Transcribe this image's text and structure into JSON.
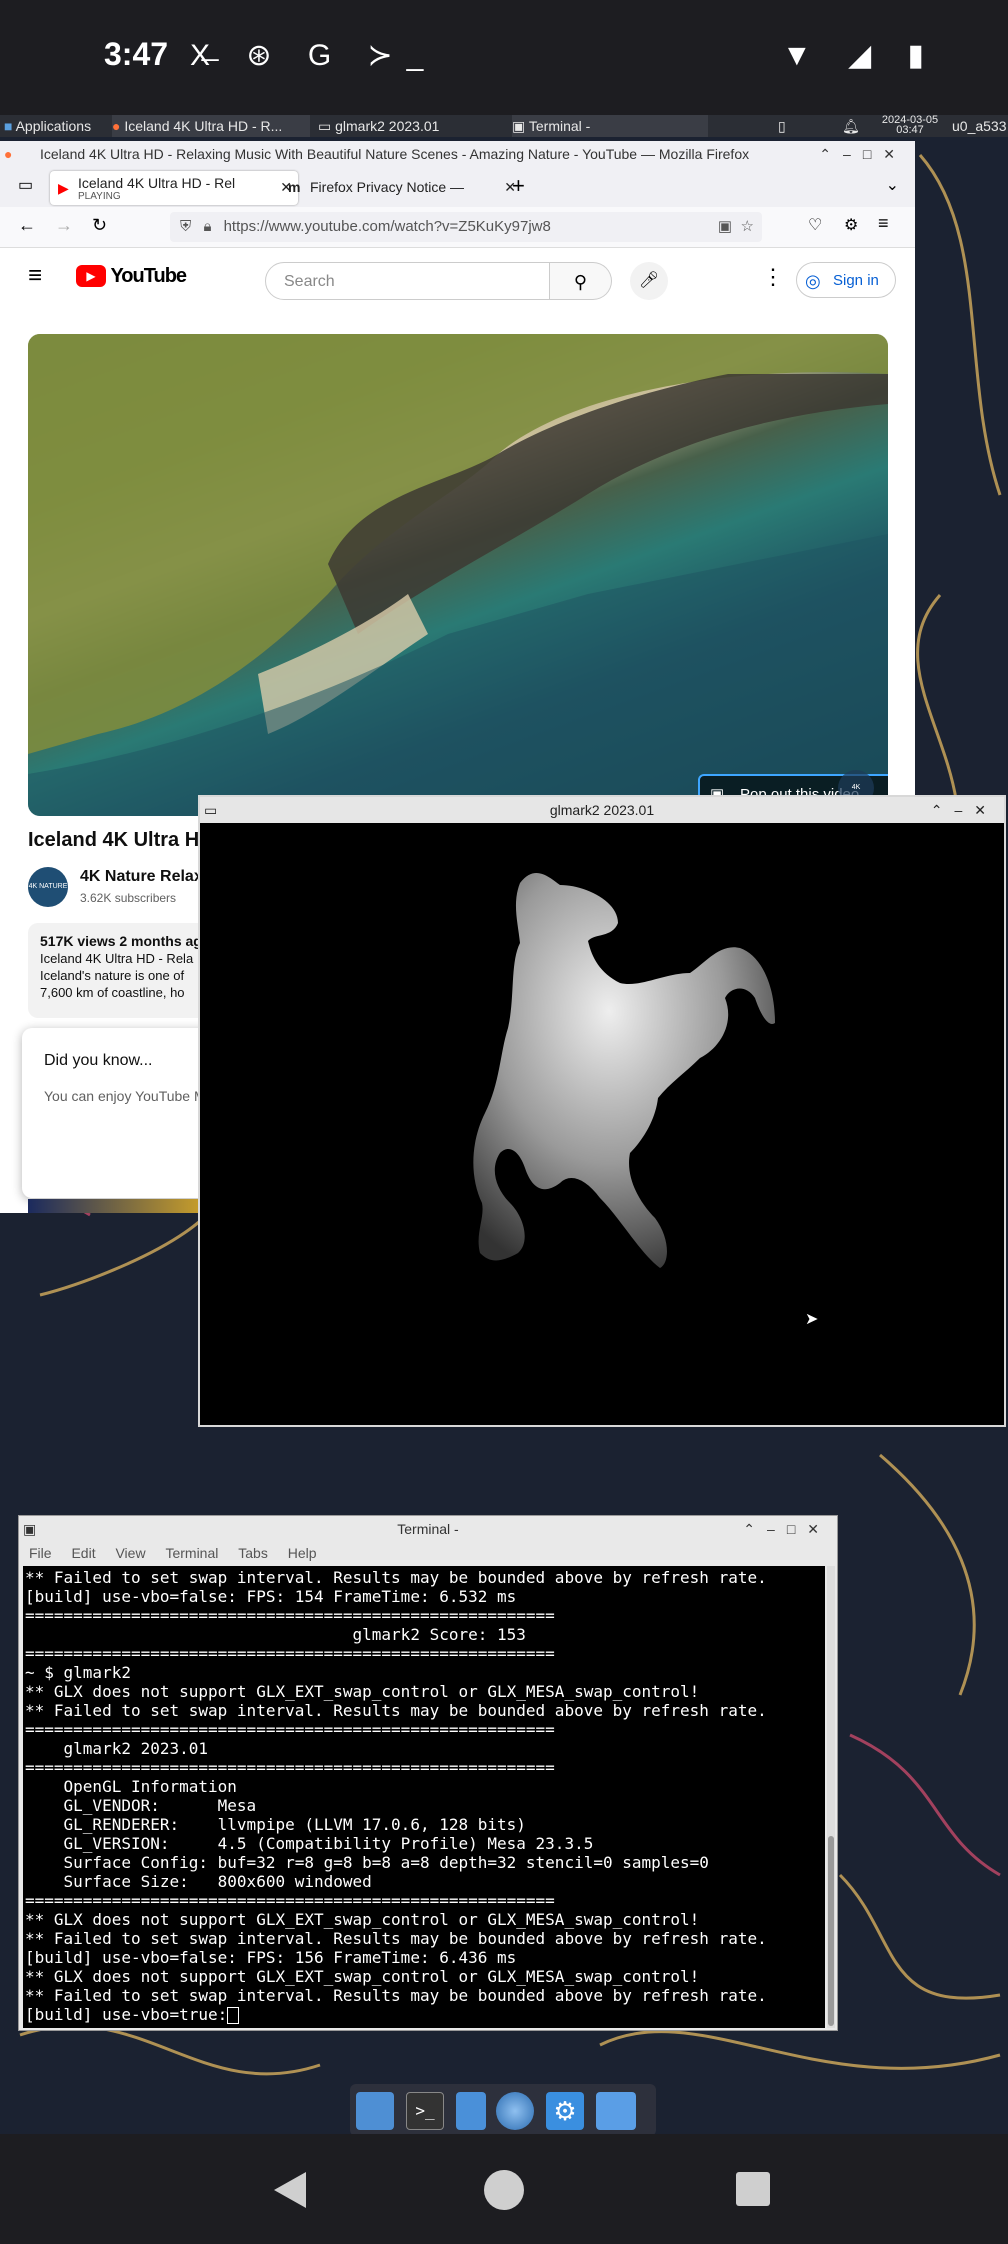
{
  "status": {
    "time": "3:47",
    "left_icons": "X̶ ⊛ G ≻_",
    "right_icons": "▼ ◢ ▮"
  },
  "panel": {
    "applications": "Applications",
    "tasks": [
      "Iceland 4K Ultra HD - R...",
      "glmark2 2023.01",
      "Terminal -"
    ],
    "date": "2024-03-05",
    "clock": "03:47",
    "user": "u0_a533"
  },
  "firefox": {
    "title": "Iceland 4K Ultra HD - Relaxing Music With Beautiful Nature Scenes - Amazing Nature - YouTube — Mozilla Firefox",
    "tabs": [
      {
        "label": "Iceland 4K Ultra HD - Rel",
        "sublabel": "PLAYING"
      },
      {
        "label": "Firefox Privacy Notice —"
      }
    ],
    "url": "https://www.youtube.com/watch?v=Z5KuKy97jw8",
    "youtube": {
      "logo": "YouTube",
      "search_placeholder": "Search",
      "sign_in": "Sign in",
      "popout": "Pop out this video",
      "video_title": "Iceland 4K Ultra HD",
      "channel": "4K Nature Relaxa",
      "subscribers": "3.62K subscribers",
      "stats": "517K views  2 months ag",
      "desc1": "Iceland 4K Ultra HD - Rela",
      "desc2": "Iceland's nature is one of",
      "desc3": "7,600 km of coastline, ho",
      "didyouknow": "Did you know...",
      "didyouknow_text": "You can enjoy YouTube M",
      "channel_badge": "4K NATURE"
    }
  },
  "glmark": {
    "title": "glmark2 2023.01"
  },
  "terminal": {
    "title": "Terminal -",
    "menu": [
      "File",
      "Edit",
      "View",
      "Terminal",
      "Tabs",
      "Help"
    ],
    "lines": [
      "** Failed to set swap interval. Results may be bounded above by refresh rate.",
      "[build] use-vbo=false: FPS: 154 FrameTime: 6.532 ms",
      "=======================================================",
      "                                  glmark2 Score: 153",
      "=======================================================",
      "~ $ glmark2",
      "** GLX does not support GLX_EXT_swap_control or GLX_MESA_swap_control!",
      "** Failed to set swap interval. Results may be bounded above by refresh rate.",
      "=======================================================",
      "    glmark2 2023.01",
      "=======================================================",
      "    OpenGL Information",
      "    GL_VENDOR:      Mesa",
      "    GL_RENDERER:    llvmpipe (LLVM 17.0.6, 128 bits)",
      "    GL_VERSION:     4.5 (Compatibility Profile) Mesa 23.3.5",
      "    Surface Config: buf=32 r=8 g=8 b=8 a=8 depth=32 stencil=0 samples=0",
      "    Surface Size:   800x600 windowed",
      "=======================================================",
      "** GLX does not support GLX_EXT_swap_control or GLX_MESA_swap_control!",
      "** Failed to set swap interval. Results may be bounded above by refresh rate.",
      "[build] use-vbo=false: FPS: 156 FrameTime: 6.436 ms",
      "** GLX does not support GLX_EXT_swap_control or GLX_MESA_swap_control!",
      "** Failed to set swap interval. Results may be bounded above by refresh rate.",
      "[build] use-vbo=true:"
    ]
  },
  "colors": {
    "youtube_red": "#ff0000",
    "accent_blue": "#065fd4",
    "terminal_green": "#4caf50"
  }
}
